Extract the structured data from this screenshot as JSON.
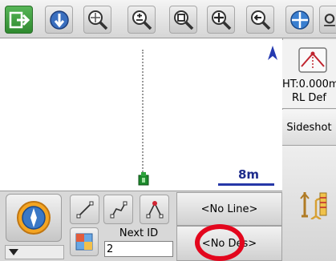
{
  "toolbar": {
    "icons": [
      "exit-icon",
      "target-down-icon",
      "zoom-fit-icon",
      "zoom-in-out-icon",
      "zoom-window-icon",
      "pan-icon",
      "zoom-back-icon",
      "crosshair-icon",
      "settings-icon"
    ]
  },
  "map": {
    "north_label": "A",
    "scale_label": "8m"
  },
  "right_panel": {
    "ht_line1": "HT:0.000m",
    "ht_line2": "RL Def",
    "sideshot_label": "Sideshot"
  },
  "bottom": {
    "next_id_label": "Next ID",
    "next_id_value": "2",
    "line_label": "<No Line>",
    "design_label": "<No Des>"
  },
  "colors": {
    "accent_red": "#e3061d",
    "scale_blue": "#2637a8",
    "toolbar_green": "#3c9a3c"
  }
}
